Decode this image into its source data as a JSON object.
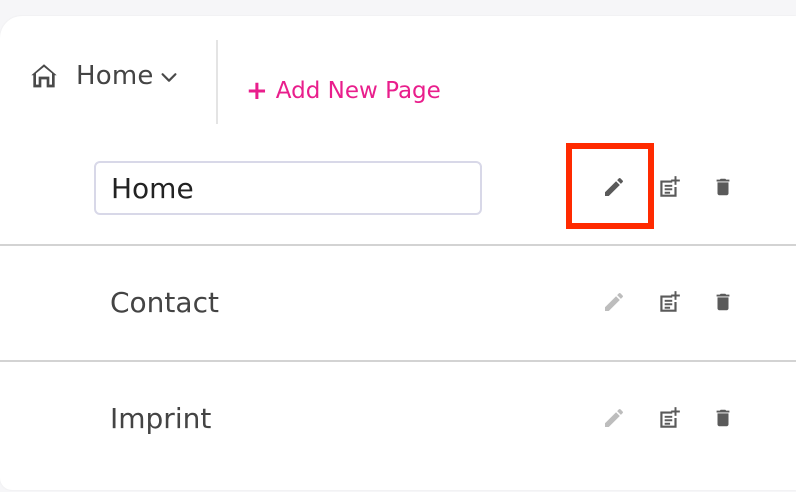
{
  "header": {
    "current_page": "Home",
    "add_page_label": "Add New Page"
  },
  "pages": [
    {
      "name": "Home",
      "editing": true
    },
    {
      "name": "Contact",
      "editing": false
    },
    {
      "name": "Imprint",
      "editing": false
    }
  ],
  "icons": {
    "home": "home-icon",
    "dropdown": "chevron-down-icon",
    "edit": "pencil-icon",
    "add_subpage": "add-subpage-icon",
    "delete": "trash-icon"
  },
  "colors": {
    "accent": "#e91e8c",
    "text": "#444444",
    "icon_active": "#5a5a5a",
    "icon_muted": "#bdbdbd",
    "highlight": "#ff2a00"
  }
}
